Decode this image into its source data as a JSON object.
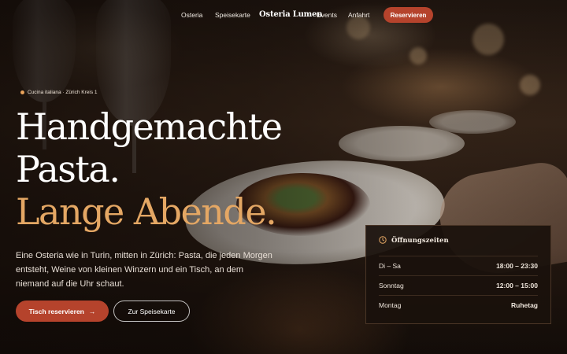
{
  "nav": {
    "links": [
      "Osteria",
      "Speisekarte"
    ],
    "brand": "Osteria Lumen",
    "links_right": [
      "Events",
      "Anfahrt"
    ],
    "cta": "Reservieren"
  },
  "hero": {
    "eyebrow": "Cucina italiana · Zürich Kreis 1",
    "headline_line1": "Handgemachte",
    "headline_line2": "Pasta.",
    "headline_line3": "Lange Abende.",
    "lead": "Eine Osteria wie in Turin, mitten in Zürich: Pasta, die jeden Morgen entsteht, Weine von kleinen Winzern und ein Tisch, an dem niemand auf die Uhr schaut.",
    "primary_button": "Tisch reservieren",
    "primary_button_arrow": "→",
    "secondary_button": "Zur Speisekarte"
  },
  "hours": {
    "title": "Öffnungszeiten",
    "rows": [
      {
        "day": "Di – Sa",
        "time": "18:00 – 23:30"
      },
      {
        "day": "Sonntag",
        "time": "12:00 – 15:00"
      },
      {
        "day": "Montag",
        "time": "Ruhetag"
      }
    ]
  },
  "colors": {
    "accent": "#b5432c",
    "headline_accent": "#e4a764",
    "card_background": "#1a110c"
  },
  "icons": [
    "clock-icon",
    "arrow-right-icon",
    "dot-icon"
  ]
}
